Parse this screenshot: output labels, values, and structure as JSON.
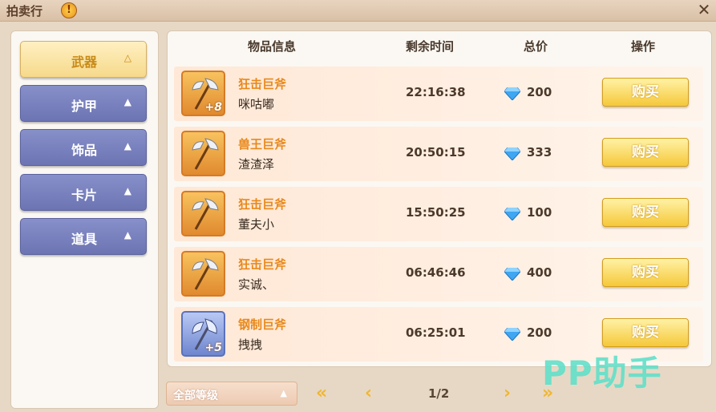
{
  "window": {
    "title": "拍卖行",
    "warning_glyph": "!",
    "close_glyph": "✕"
  },
  "sidebar": {
    "items": [
      {
        "label": "武器",
        "arrow": "△",
        "active": true
      },
      {
        "label": "护甲",
        "arrow": "▲",
        "active": false
      },
      {
        "label": "饰品",
        "arrow": "▲",
        "active": false
      },
      {
        "label": "卡片",
        "arrow": "▲",
        "active": false
      },
      {
        "label": "道具",
        "arrow": "▲",
        "active": false
      }
    ]
  },
  "table": {
    "headers": {
      "item_info": "物品信息",
      "remaining_time": "剩余时间",
      "total_price": "总价",
      "action": "操作"
    },
    "rows": [
      {
        "item_name": "狂击巨斧",
        "seller": "咪咕嘟",
        "plus": "+8",
        "time": "22:16:38",
        "price": "200",
        "buy_label": "购买",
        "icon": "axe-icon"
      },
      {
        "item_name": "兽王巨斧",
        "seller": "渣渣泽",
        "plus": "",
        "time": "20:50:15",
        "price": "333",
        "buy_label": "购买",
        "icon": "axe-icon"
      },
      {
        "item_name": "狂击巨斧",
        "seller": "董夫小",
        "plus": "",
        "time": "15:50:25",
        "price": "100",
        "buy_label": "购买",
        "icon": "axe-icon"
      },
      {
        "item_name": "狂击巨斧",
        "seller": "实诚、",
        "plus": "",
        "time": "06:46:46",
        "price": "400",
        "buy_label": "购买",
        "icon": "axe-icon"
      },
      {
        "item_name": "钢制巨斧",
        "seller": "拽拽",
        "plus": "+5",
        "time": "06:25:01",
        "price": "200",
        "buy_label": "购买",
        "icon": "steel-axe-icon"
      }
    ]
  },
  "footer": {
    "level_filter": "全部等级",
    "level_arrow": "▲",
    "page": "1/2",
    "first_glyph": "«",
    "prev_glyph": "‹",
    "next_glyph": "›",
    "last_glyph": "»"
  },
  "watermark": "PP助手",
  "colors": {
    "accent_orange": "#e8891c",
    "buy_yellow": "#f5c83a",
    "tab_purple": "#7880bd",
    "diamond": "#3fa6f2"
  }
}
